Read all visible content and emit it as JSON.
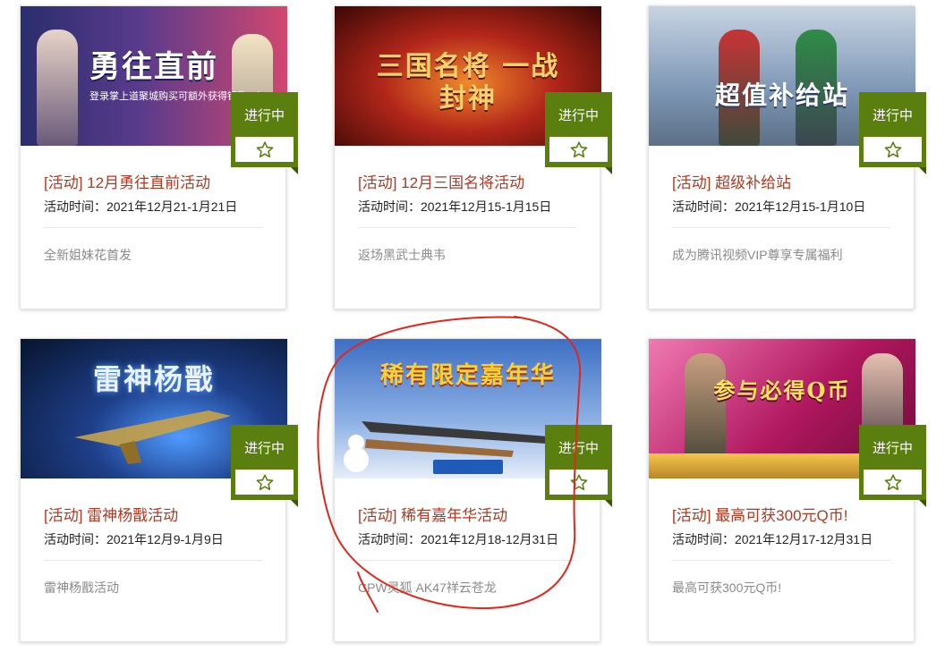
{
  "cards": [
    {
      "banner_text": "勇往直前",
      "banner_sub": "登录掌上道聚城购买可额外获得钥匙1个",
      "banner_bg": "#2a2d6e",
      "banner_bg2": "#d1476f",
      "banner_color": "#ffffff",
      "status": "进行中",
      "title": "[活动] 12月勇往直前活动",
      "time": "活动时间：2021年12月21-1月21日",
      "desc": "全新姐妹花首发"
    },
    {
      "banner_text": "三国名将 一战封神",
      "banner_sub": "",
      "banner_bg": "#5c0f08",
      "banner_bg2": "#e4612a",
      "banner_color": "#f6d36b",
      "status": "进行中",
      "title": "[活动] 12月三国名将活动",
      "time": "活动时间：2021年12月15-1月15日",
      "desc": "返场黑武士典韦"
    },
    {
      "banner_text": "超值补给站",
      "banner_sub": "",
      "banner_bg": "#7d97b6",
      "banner_bg2": "#dfe6ee",
      "banner_color": "#ffffff",
      "status": "进行中",
      "title": "[活动] 超级补给站",
      "time": "活动时间：2021年12月15-1月10日",
      "desc": "成为腾讯视频VIP尊享专属福利"
    },
    {
      "banner_text": "雷神杨戬",
      "banner_sub": "",
      "banner_bg": "#07142e",
      "banner_bg2": "#2f6fd1",
      "banner_color": "#e9f2ff",
      "status": "进行中",
      "title": "[活动] 雷神杨戬活动",
      "time": "活动时间：2021年12月9-1月9日",
      "desc": "雷神杨戬活动"
    },
    {
      "banner_text": "稀有限定嘉年华",
      "banner_sub": "",
      "banner_bg": "#3d6fc4",
      "banner_bg2": "#c9dcf2",
      "banner_color": "#f6d23a",
      "status": "进行中",
      "title": "[活动] 稀有嘉年华活动",
      "time": "活动时间：2021年12月18-12月31日",
      "desc": "CPW灵狐 AK47祥云苍龙"
    },
    {
      "banner_text": "参与必得Q币",
      "banner_sub": "",
      "banner_bg": "#b0175f",
      "banner_bg2": "#f07ab2",
      "banner_color": "#ffe45c",
      "status": "进行中",
      "title": "[活动] 最高可获300元Q币!",
      "time": "活动时间：2021年12月17-12月31日",
      "desc": "最高可获300元Q币!"
    }
  ]
}
